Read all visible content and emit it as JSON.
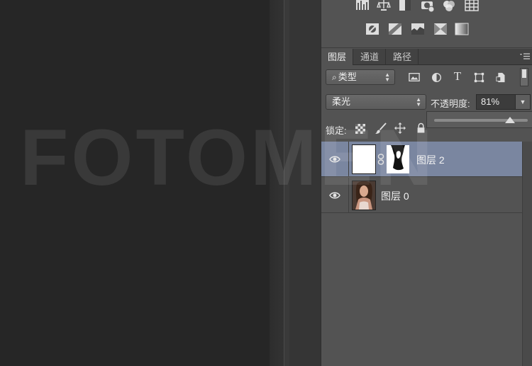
{
  "tabs": [
    {
      "label": "图层",
      "active": true
    },
    {
      "label": "通道",
      "active": false
    },
    {
      "label": "路径",
      "active": false
    }
  ],
  "filter": {
    "label": "类型"
  },
  "blend_mode": {
    "value": "柔光"
  },
  "opacity": {
    "label": "不透明度:",
    "value": "81%",
    "level_percent": 81
  },
  "lock": {
    "label": "锁定:"
  },
  "layers": [
    {
      "name": "图层 2",
      "selected": true,
      "visible": true,
      "has_mask": true
    },
    {
      "name": "图层 0",
      "selected": false,
      "visible": true,
      "has_mask": false
    }
  ],
  "watermark": {
    "text": "FOTOMEN"
  },
  "colors": {
    "panel_bg": "#535353",
    "selected_row": "#7a86a0",
    "canvas_bg": "#262626"
  },
  "icons": {
    "adjustments_row1": [
      "levels-icon",
      "curves-scale-icon",
      "exposure-icon",
      "photo-filter-icon",
      "channel-mixer-icon",
      "color-lookup-icon"
    ],
    "adjustments_row2": [
      "invert-icon",
      "posterize-icon",
      "threshold-icon",
      "selective-color-icon",
      "gradient-map-icon"
    ],
    "filter_tools": [
      "image-filter-icon",
      "adjustment-filter-icon",
      "type-filter-icon",
      "shape-filter-icon",
      "smart-object-filter-icon",
      "filter-toggle-icon"
    ],
    "lock_tools": [
      "lock-transparent-icon",
      "lock-paint-icon",
      "lock-move-icon",
      "lock-all-icon"
    ]
  }
}
